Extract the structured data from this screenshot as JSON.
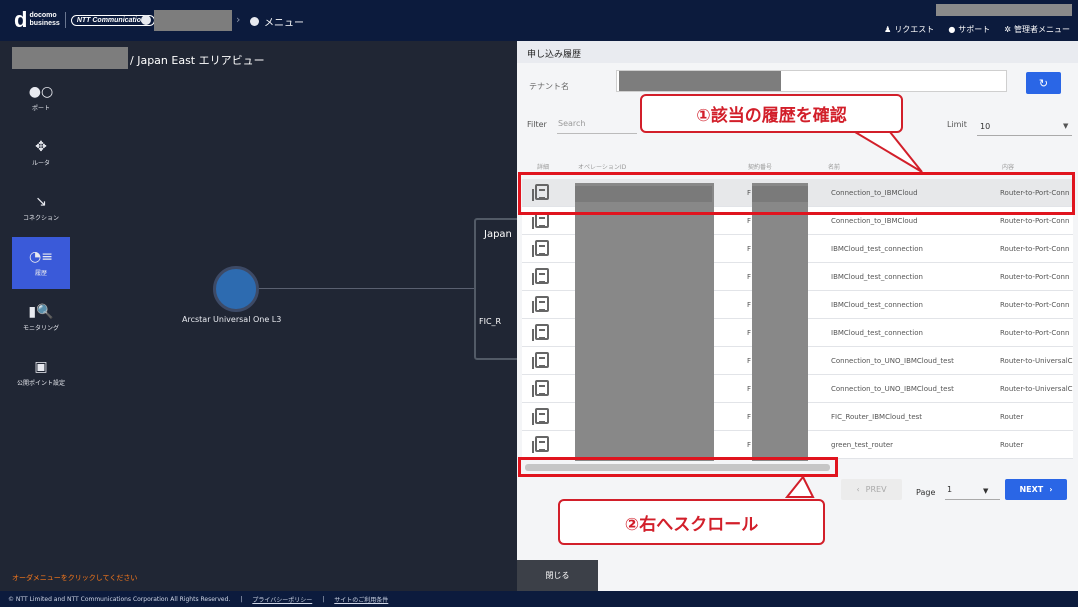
{
  "header": {
    "brand_line1": "docomo",
    "brand_line2": "business",
    "ntt_logo": "NTT Communications",
    "menu_label": "メニュー",
    "nav": [
      {
        "icon": "bell-icon",
        "label": "リクエスト"
      },
      {
        "icon": "help-icon",
        "label": "サポート"
      },
      {
        "icon": "gear-icon",
        "label": "管理者メニュー"
      }
    ]
  },
  "area_title": "/ Japan East エリアビュー",
  "sidebar": [
    {
      "icon": "port-icon",
      "label": "ポート"
    },
    {
      "icon": "router-icon",
      "label": "ルータ"
    },
    {
      "icon": "connection-icon",
      "label": "コネクション"
    },
    {
      "icon": "history-icon",
      "label": "履歴",
      "active": true
    },
    {
      "icon": "monitoring-icon",
      "label": "モニタリング"
    },
    {
      "icon": "public-point-icon",
      "label": "公開ポイント設定"
    }
  ],
  "map": {
    "node_label": "Arcstar Universal One L3",
    "region_label": "Japan",
    "fic_label": "FIC_R"
  },
  "order_hint": "オーダメニューをクリックしてください",
  "footer": {
    "copyright": "© NTT Limited and NTT Communications Corporation All Rights Reserved.",
    "privacy": "プライバシーポリシー",
    "terms": "サイトのご利用条件"
  },
  "panel": {
    "title": "申し込み履歴",
    "tenant_label": "テナント名",
    "filter_label": "Filter",
    "search_placeholder": "Search",
    "limit_label": "Limit",
    "limit_value": "10",
    "columns": [
      "詳細",
      "オペレーションID",
      "契約番号",
      "名前",
      "内容"
    ],
    "rows": [
      {
        "contract": "F",
        "name": "Connection_to_IBMCloud",
        "content": "Router-to-Port-Conn"
      },
      {
        "contract": "F",
        "name": "Connection_to_IBMCloud",
        "content": "Router-to-Port-Conn"
      },
      {
        "contract": "F",
        "name": "IBMCloud_test_connection",
        "content": "Router-to-Port-Conn"
      },
      {
        "contract": "F",
        "name": "IBMCloud_test_connection",
        "content": "Router-to-Port-Conn"
      },
      {
        "contract": "F",
        "name": "IBMCloud_test_connection",
        "content": "Router-to-Port-Conn"
      },
      {
        "contract": "F",
        "name": "IBMCloud_test_connection",
        "content": "Router-to-Port-Conn"
      },
      {
        "contract": "F",
        "name": "Connection_to_UNO_IBMCloud_test",
        "content": "Router-to-UniversalC"
      },
      {
        "contract": "F",
        "name": "Connection_to_UNO_IBMCloud_test",
        "content": "Router-to-UniversalC"
      },
      {
        "contract": "F",
        "name": "FIC_Router_IBMCloud_test",
        "content": "Router"
      },
      {
        "contract": "F",
        "name": "green_test_router",
        "content": "Router"
      }
    ],
    "prev_label": "PREV",
    "page_label": "Page",
    "page_value": "1",
    "next_label": "NEXT",
    "close_label": "閉じる"
  },
  "callouts": {
    "check_history": "①該当の履歴を確認",
    "scroll_right": "②右へスクロール"
  },
  "colors": {
    "accent": "#2a66e6",
    "highlight": "#e0141e"
  }
}
